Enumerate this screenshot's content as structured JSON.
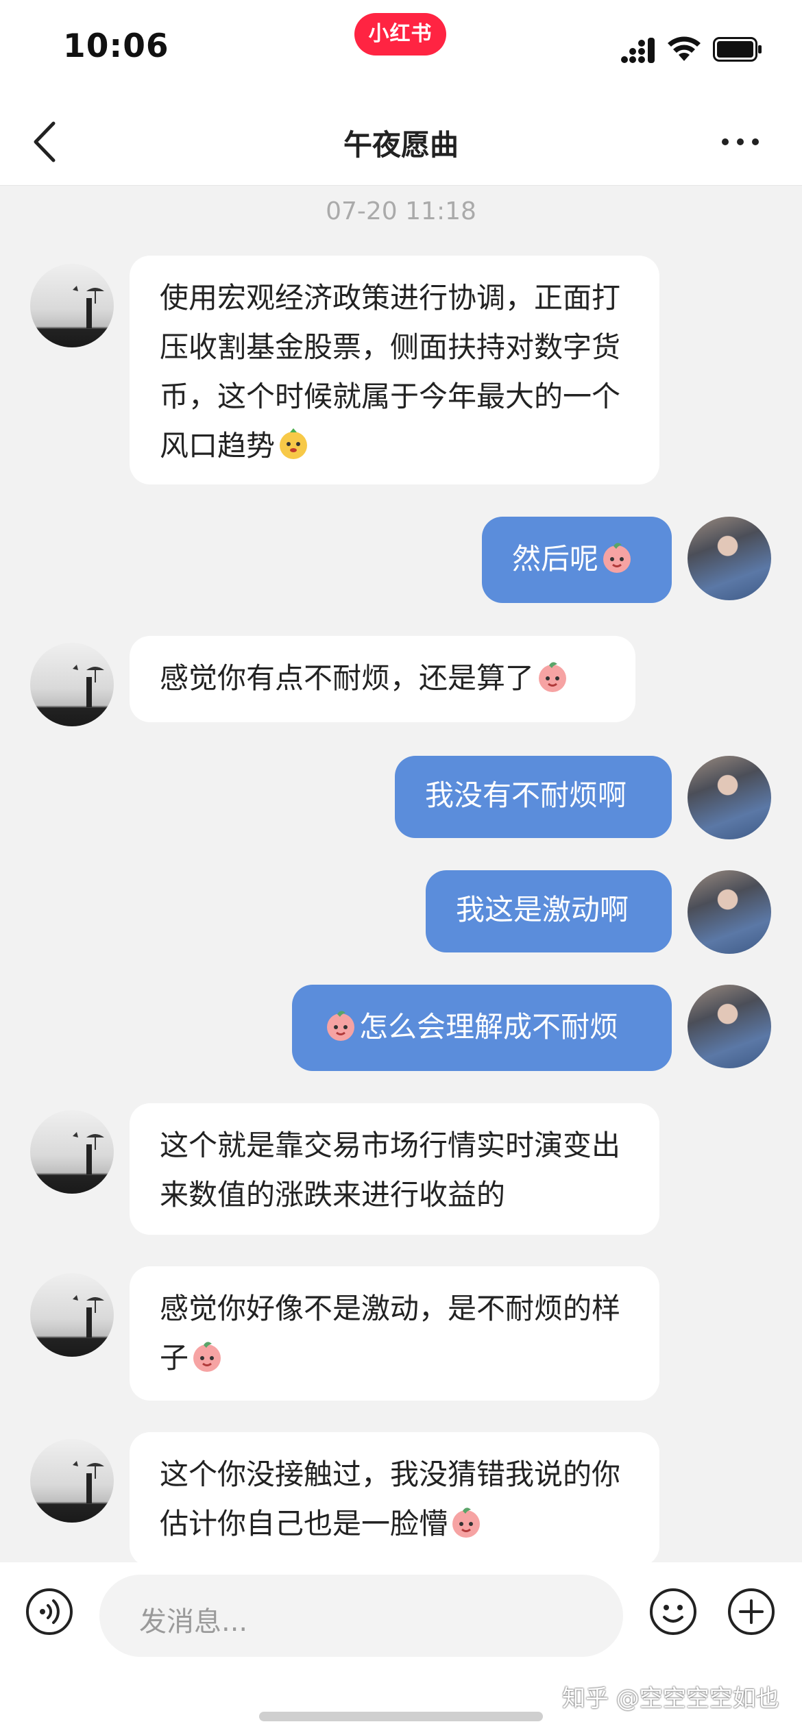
{
  "status_bar": {
    "time": "10:06",
    "brand": "小红书"
  },
  "nav": {
    "title": "午夜愿曲"
  },
  "chat": {
    "timestamp": "07-20 11:18",
    "messages": [
      {
        "from": "other",
        "text": "使用宏观经济政策进行协调，正面打压收割基金股票，侧面扶持对数字货币，这个时候就属于今年最大的一个风口趋势"
      },
      {
        "from": "self",
        "text": "然后呢"
      },
      {
        "from": "other",
        "text": "感觉你有点不耐烦，还是算了"
      },
      {
        "from": "self",
        "text": "我没有不耐烦啊"
      },
      {
        "from": "self",
        "text": "我这是激动啊"
      },
      {
        "from": "self",
        "text": "怎么会理解成不耐烦"
      },
      {
        "from": "other",
        "text": "这个就是靠交易市场行情实时演变出来数值的涨跌来进行收益的"
      },
      {
        "from": "other",
        "text": "感觉你好像不是激动，是不耐烦的样子"
      },
      {
        "from": "other",
        "text": "这个你没接触过，我没猜错我说的你估计你自己也是一脸懵"
      }
    ]
  },
  "input": {
    "placeholder": "发消息..."
  },
  "watermark": "知乎 @空空空空如也",
  "colors": {
    "brand": "#ff2442",
    "self_bubble": "#5b8ddb",
    "other_bubble": "#ffffff",
    "background": "#f2f2f2"
  }
}
